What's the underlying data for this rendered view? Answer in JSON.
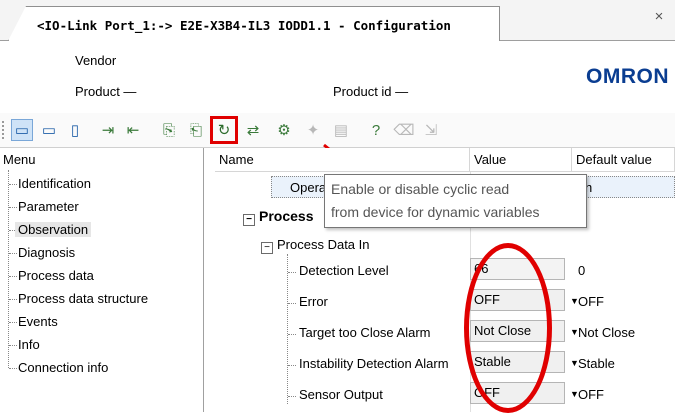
{
  "window": {
    "tab_title": "<IO-Link Port_1:-> E2E-X3B4-IL3 IODD1.1 - Configuration",
    "close_glyph": "×"
  },
  "header": {
    "vendor_label": "Vendor",
    "product_label": "Product —",
    "product_id_label": "Product id —",
    "logo_text": "OMRON",
    "logo_color": "#0a3d91"
  },
  "toolbar": {
    "buttons": [
      {
        "icon": "layout-full-icon",
        "glyph": "▭",
        "state": "selected"
      },
      {
        "icon": "layout-split-icon",
        "glyph": "▭",
        "state": "normal"
      },
      {
        "icon": "layout-panel-icon",
        "glyph": "▯",
        "state": "normal"
      },
      {
        "icon": "upload-icon",
        "glyph": "⇥",
        "state": "normal"
      },
      {
        "icon": "download-icon",
        "glyph": "⇤",
        "state": "normal"
      },
      {
        "icon": "device-read-icon",
        "glyph": "⎘",
        "state": "normal"
      },
      {
        "icon": "device-write-icon",
        "glyph": "⎗",
        "state": "normal"
      },
      {
        "icon": "cyclic-read-icon",
        "glyph": "↻",
        "state": "highlighted"
      },
      {
        "icon": "compare-icon",
        "glyph": "⇄",
        "state": "normal"
      },
      {
        "icon": "parameter-icon",
        "glyph": "⚙",
        "state": "normal"
      },
      {
        "icon": "teach-icon",
        "glyph": "✦",
        "state": "disabled"
      },
      {
        "icon": "report-icon",
        "glyph": "▤",
        "state": "disabled"
      },
      {
        "icon": "help-icon",
        "glyph": "?",
        "state": "normal"
      },
      {
        "icon": "delete-icon",
        "glyph": "⌫",
        "state": "disabled"
      },
      {
        "icon": "export-icon",
        "glyph": "⇲",
        "state": "disabled"
      }
    ]
  },
  "menu": {
    "title": "Menu",
    "items": [
      {
        "label": "Identification"
      },
      {
        "label": "Parameter"
      },
      {
        "label": "Observation",
        "selected": true
      },
      {
        "label": "Diagnosis"
      },
      {
        "label": "Process data"
      },
      {
        "label": "Process data structure"
      },
      {
        "label": "Events"
      },
      {
        "label": "Info"
      },
      {
        "label": "Connection info"
      }
    ]
  },
  "grid": {
    "columns": {
      "name": "Name",
      "value": "Value",
      "default": "Default value"
    },
    "operating_label": "Operating",
    "operating_value_partial": "h",
    "group_label": "Process",
    "subgroup_label": "Process Data In",
    "rows": [
      {
        "name": "Detection Level",
        "value": "66",
        "default": "0",
        "dropdown": false
      },
      {
        "name": "Error",
        "value": "OFF",
        "default": "OFF",
        "dropdown": true
      },
      {
        "name": "Target too Close Alarm",
        "value": "Not Close",
        "default": "Not Close",
        "dropdown": true
      },
      {
        "name": "Instability Detection Alarm",
        "value": "Stable",
        "default": "Stable",
        "dropdown": true
      },
      {
        "name": "Sensor Output",
        "value": "OFF",
        "default": "OFF",
        "dropdown": true
      }
    ]
  },
  "tooltip": {
    "line1": "Enable or disable cyclic read",
    "line2": "from device for dynamic variables"
  },
  "annotation_color": "#e00000"
}
